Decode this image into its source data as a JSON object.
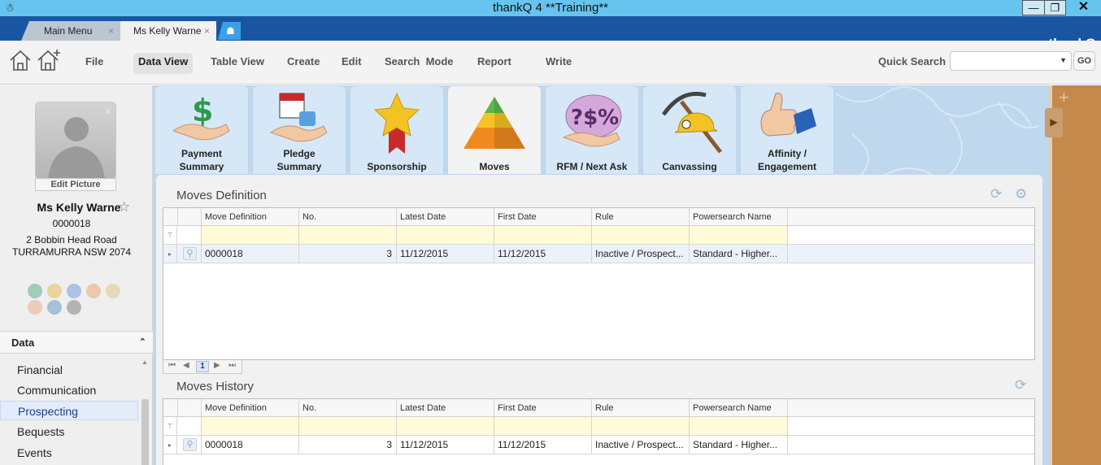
{
  "window": {
    "title": "thankQ 4 **Training**",
    "min_glyph": "—",
    "max_glyph": "❐",
    "close_glyph": "✕",
    "app_icon": "☃"
  },
  "tabs": [
    {
      "label": "Main Menu",
      "close": "×"
    },
    {
      "label": "Ms Kelly Warne",
      "close": "×"
    }
  ],
  "new_tab_glyph": "☗",
  "brand": "thankQ",
  "menu": {
    "items": [
      "File",
      "Data View",
      "Table View",
      "Create",
      "Edit",
      "Search  Mode",
      "Report",
      "Write"
    ],
    "active": "Data View"
  },
  "quick_search": {
    "label": "Quick Search",
    "value": "",
    "go": "GO"
  },
  "contact": {
    "edit_picture": "Edit Picture",
    "close_glyph": "x",
    "name": "Ms Kelly Warne",
    "star": "☆",
    "id": "0000018",
    "address1": "2 Bobbin Head Road",
    "address2": "TURRAMURRA NSW 2074"
  },
  "data_panel": {
    "header": "Data",
    "chevron": "⌃",
    "items": [
      "Financial",
      "Communication",
      "Prospecting",
      "Bequests",
      "Events"
    ],
    "selected": "Prospecting"
  },
  "module_tiles": [
    {
      "label1": "Payment",
      "label2": "Summary",
      "icon": "payment-summary-icon"
    },
    {
      "label1": "Pledge",
      "label2": "Summary",
      "icon": "pledge-summary-icon"
    },
    {
      "label1": "",
      "label2": "Sponsorship",
      "icon": "sponsorship-icon"
    },
    {
      "label1": "",
      "label2": "Moves",
      "icon": "moves-icon"
    },
    {
      "label1": "",
      "label2": "RFM / Next Ask",
      "icon": "rfm-icon"
    },
    {
      "label1": "",
      "label2": "Canvassing",
      "icon": "canvassing-icon"
    },
    {
      "label1": "Affinity /",
      "label2": "Engagement",
      "icon": "affinity-icon"
    }
  ],
  "moves_definition": {
    "title": "Moves Definition",
    "columns": [
      "Move Definition",
      "No.",
      "Latest Date",
      "First Date",
      "Rule",
      "Powersearch Name"
    ],
    "rows": [
      {
        "move_definition": "0000018",
        "no": "3",
        "latest_date": "11/12/2015",
        "first_date": "11/12/2015",
        "rule": "Inactive / Prospect...",
        "powersearch_name": "Standard - Higher..."
      }
    ],
    "pager": {
      "first": "⏮",
      "prev": "◀",
      "page": "1",
      "next": "▶",
      "last": "⏭"
    }
  },
  "moves_history": {
    "title": "Moves History",
    "columns": [
      "Move Definition",
      "No.",
      "Latest Date",
      "First Date",
      "Rule",
      "Powersearch Name"
    ],
    "rows": [
      {
        "move_definition": "0000018",
        "no": "3",
        "latest_date": "11/12/2015",
        "first_date": "11/12/2015",
        "rule": "Inactive / Prospect...",
        "powersearch_name": "Standard - Higher..."
      }
    ]
  },
  "glyphs": {
    "filter": "⊤",
    "row_arrow": "▸",
    "search": "⚲",
    "refresh": "⟳",
    "gear": "⚙",
    "dropdown": "▼",
    "cork_arrow": "▶",
    "cork_plus": "+"
  },
  "colors": {
    "titlebar": "#67c4ee",
    "tabstrip": "#1a55a2",
    "filter_row": "#fffbd8",
    "selected_row": "#edf2fa",
    "nav_selected": "#1d3f86"
  }
}
